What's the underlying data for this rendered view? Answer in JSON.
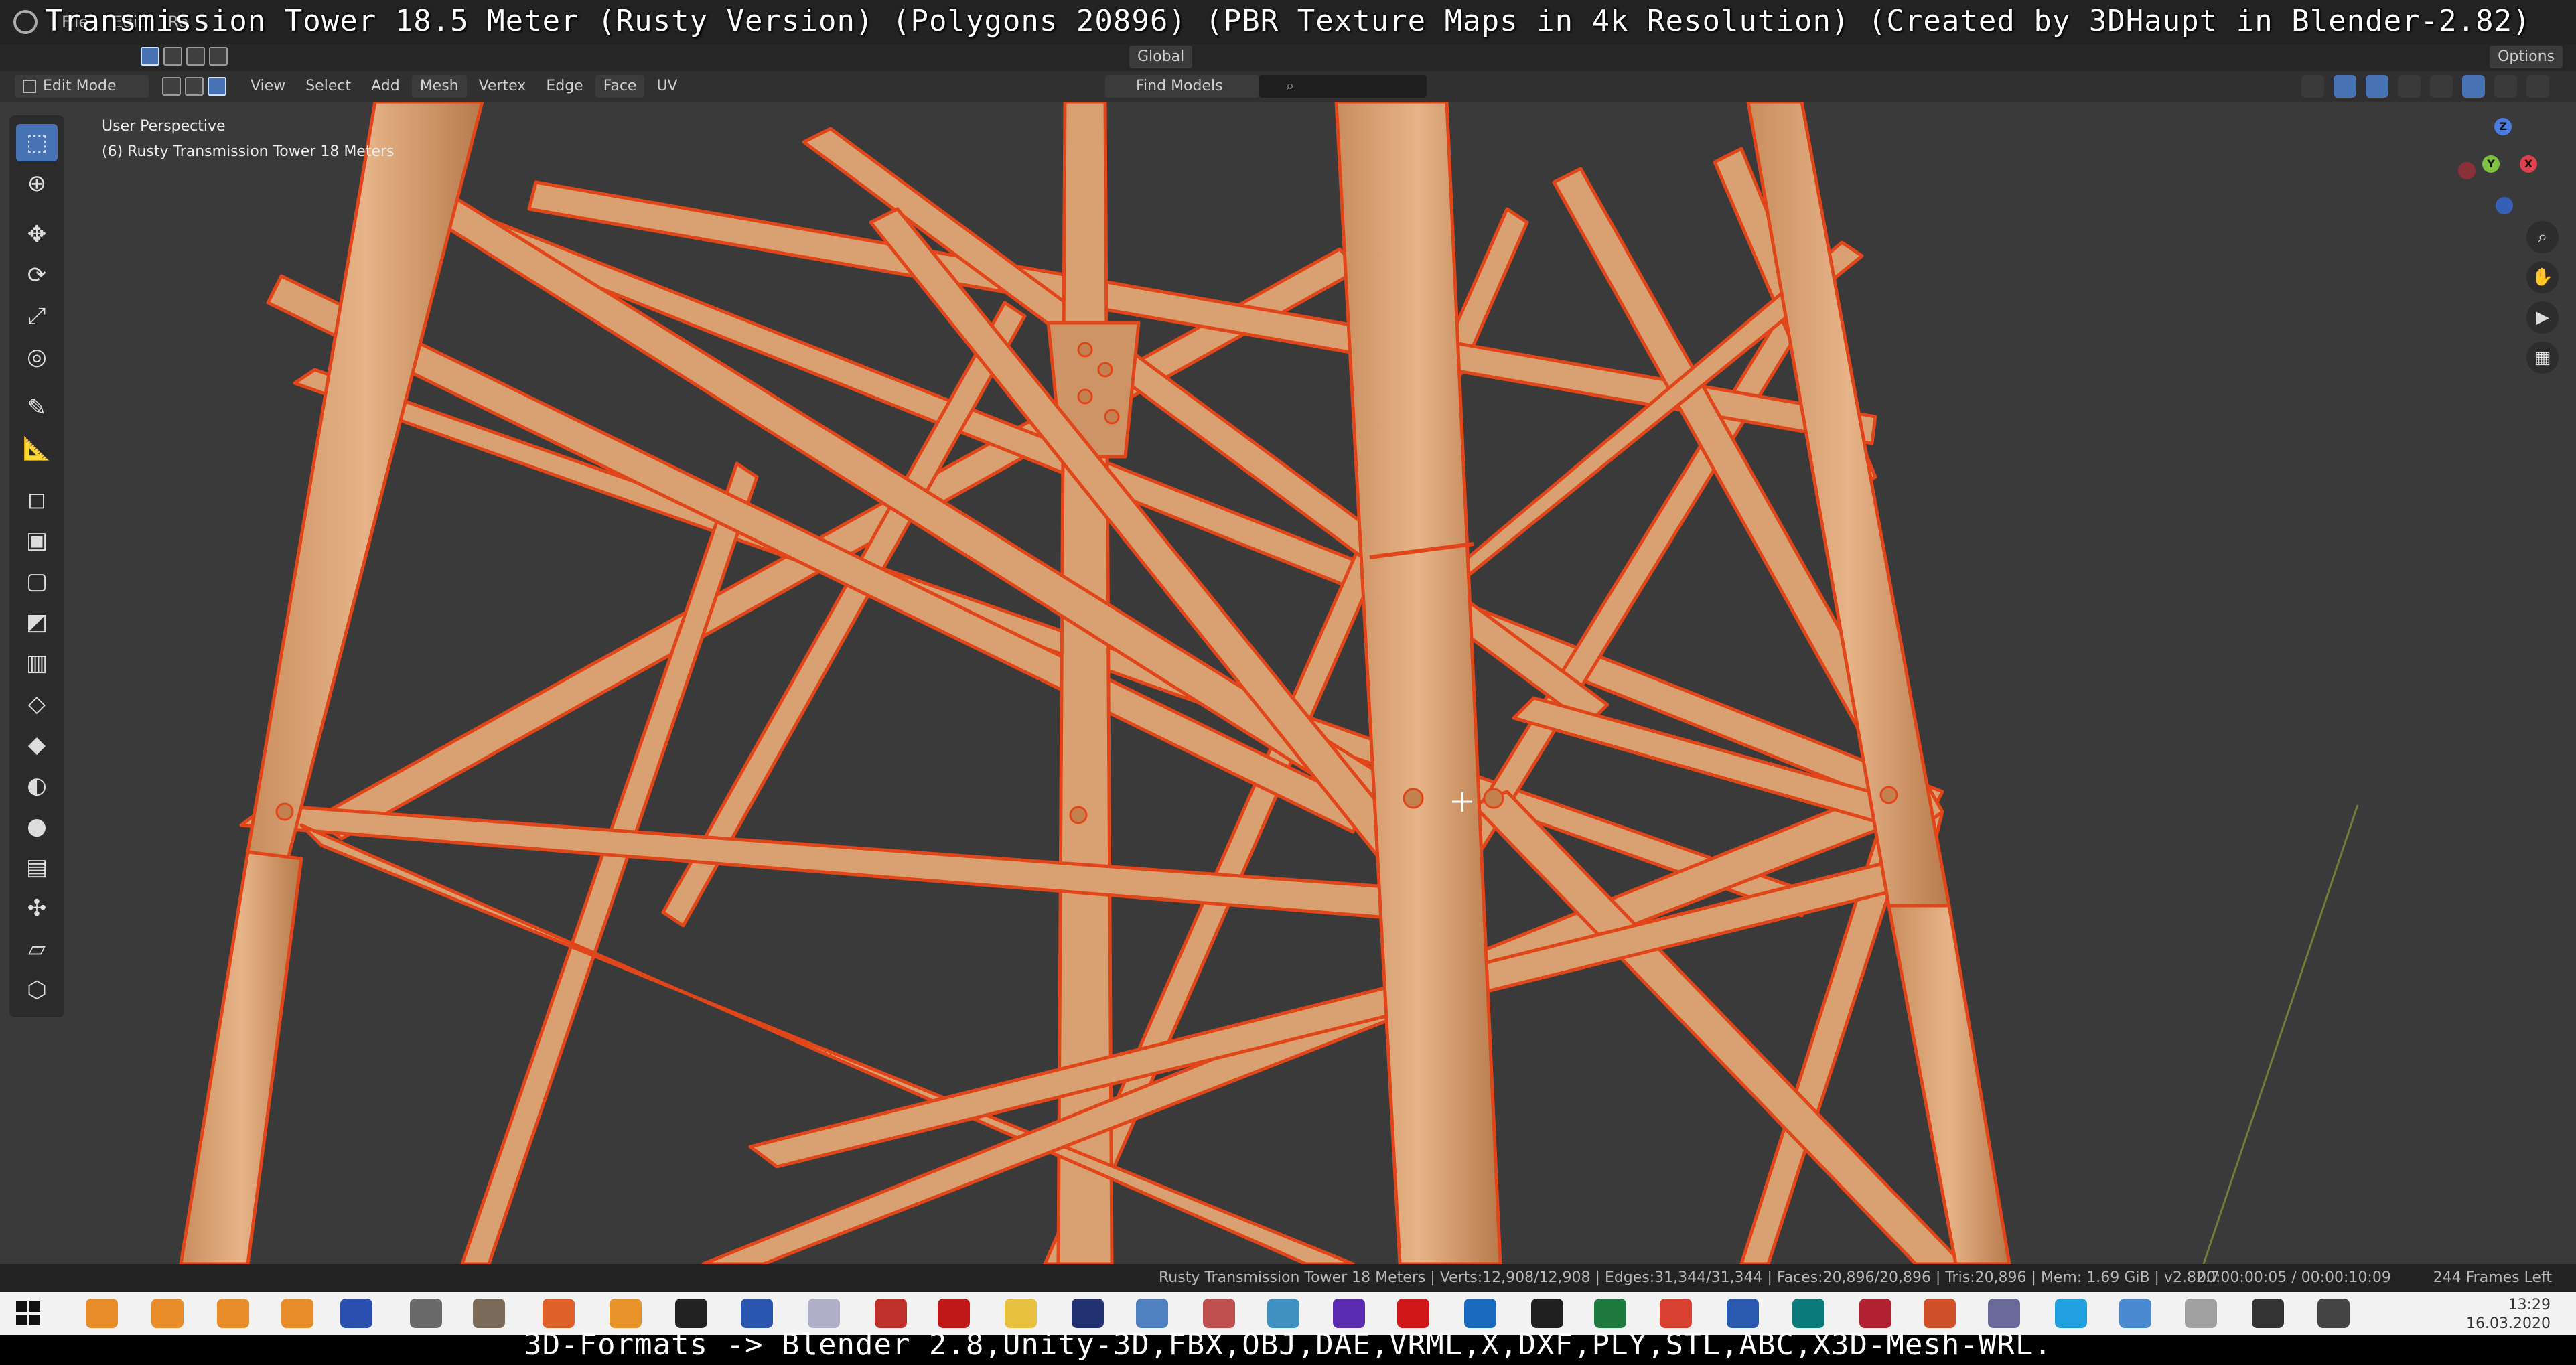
{
  "overlay": {
    "title": "Transmission Tower 18.5 Meter (Rusty Version) (Polygons 20896) (PBR Texture Maps in 4k Resolution) (Created by 3DHaupt in Blender-2.82)",
    "bottom_caption": "3D-Formats -> Blender 2.8,Unity-3D,FBX,OBJ,DAE,VRML,X,DXF,PLY,STL,ABC,X3D-Mesh-WRL."
  },
  "topbar": {
    "menu": [
      "File",
      "Edit",
      "Re"
    ]
  },
  "header": {
    "mode": "Edit Mode",
    "menus": [
      "View",
      "Select",
      "Add",
      "Mesh",
      "Vertex",
      "Edge",
      "Face",
      "UV"
    ],
    "orientation": "Global",
    "find_models": "Find Models",
    "options": "Options"
  },
  "viewport": {
    "perspective_label": "User Perspective",
    "object_label": "(6) Rusty Transmission Tower 18 Meters",
    "colors": {
      "background": "#3a3a3a",
      "steel": "#d9a171",
      "steel_shade": "#b97f52",
      "edge": "#e0461a",
      "grid_line": "#6e7d3a"
    }
  },
  "gizmo": {
    "z": "Z",
    "y": "Y",
    "x": "X"
  },
  "toolbar_icons": [
    "select-box-icon",
    "cursor-icon",
    "move-icon",
    "rotate-icon",
    "scale-icon",
    "transform-icon",
    "annotate-icon",
    "measure-icon",
    "add-cube-icon",
    "extrude-icon",
    "inset-icon",
    "bevel-icon",
    "loop-cut-icon",
    "knife-icon",
    "poly-build-icon",
    "spin-icon",
    "smooth-icon",
    "edge-slide-icon",
    "shrink-icon",
    "shear-icon",
    "rip-icon"
  ],
  "statusbar": {
    "stats": "Rusty Transmission Tower 18 Meters | Verts:12,908/12,908 | Edges:31,344/31,344 | Faces:20,896/20,896 | Tris:20,896 | Mem: 1.69 GiB | v2.82.7",
    "timecode": "00:00:00:05 / 00:00:10:09",
    "frames": "244 Frames Left"
  },
  "taskbar": {
    "time": "13:29",
    "date": "16.03.2020"
  }
}
